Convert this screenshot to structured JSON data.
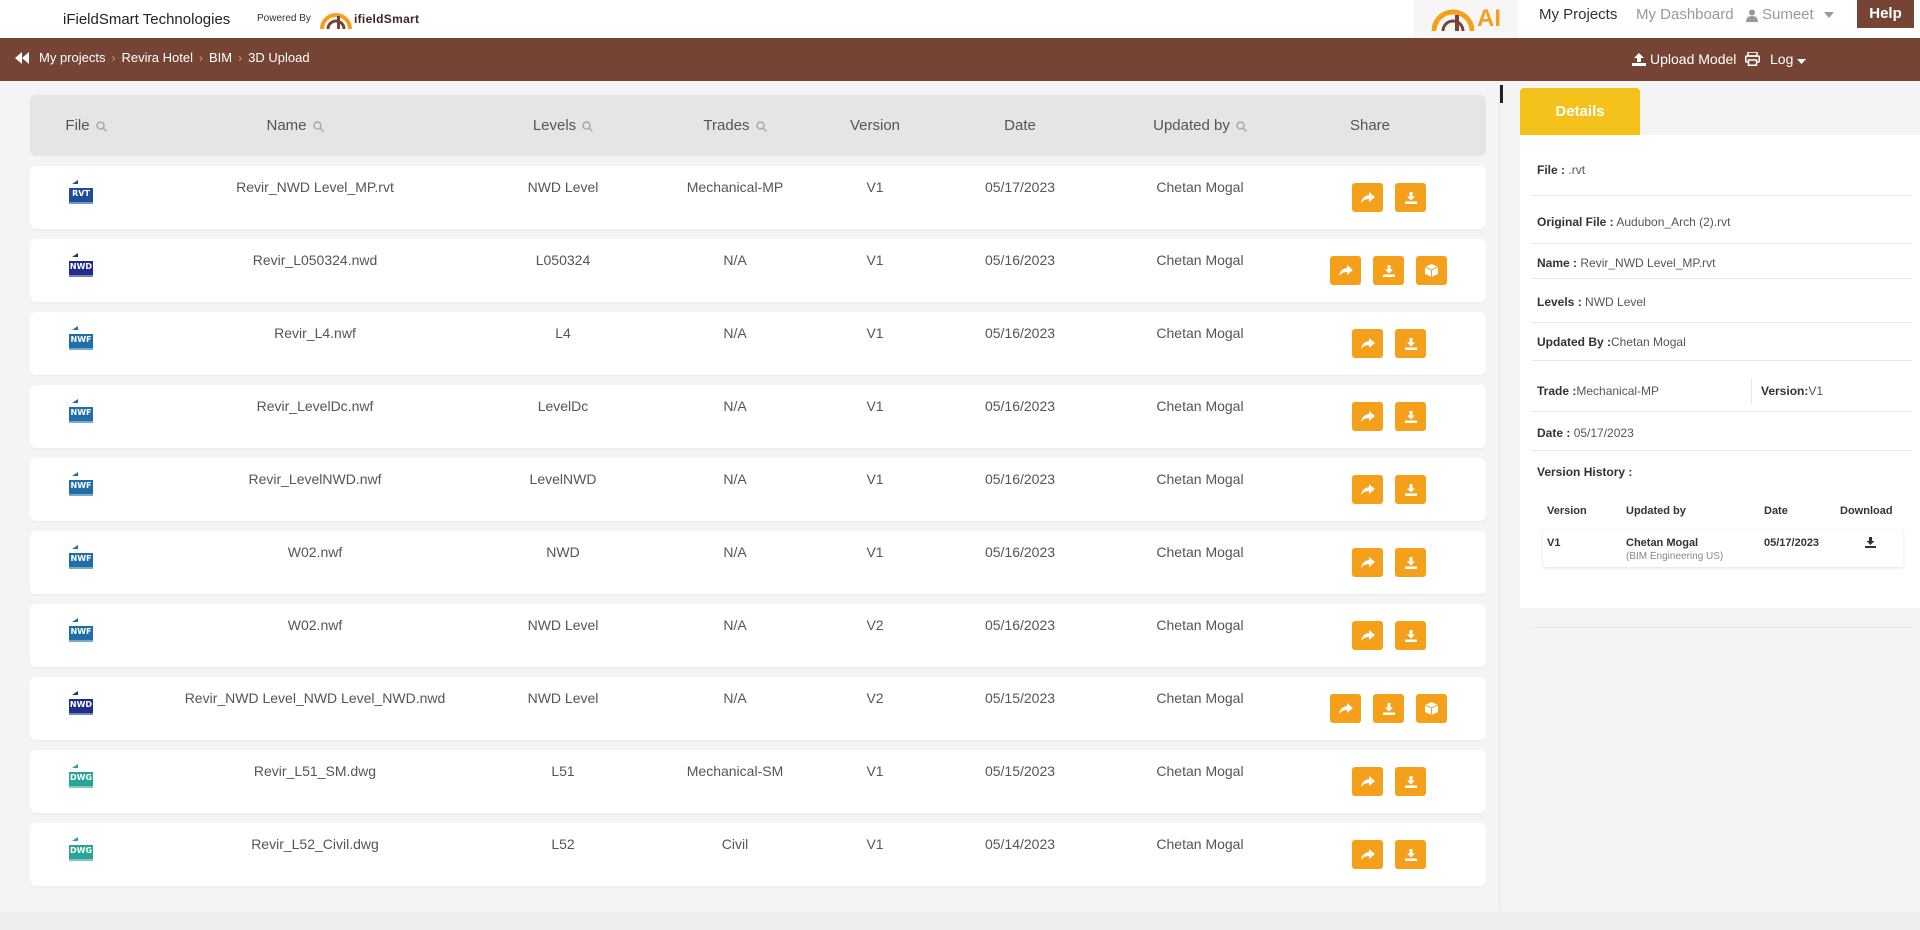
{
  "header": {
    "company": "iFieldSmart Technologies",
    "powered_by": "Powered By",
    "brand": "ifieldSmart",
    "ai_text": "AI",
    "nav": {
      "my_projects": "My Projects",
      "my_dashboard": "My Dashboard",
      "user": "Sumeet",
      "help": "Help"
    }
  },
  "navbar": {
    "breadcrumb": [
      "My projects",
      "Revira Hotel",
      "BIM",
      "3D Upload"
    ],
    "upload_model": "Upload Model",
    "log": "Log"
  },
  "table": {
    "columns": [
      "File",
      "Name",
      "Levels",
      "Trades",
      "Version",
      "Date",
      "Updated by",
      "Share"
    ],
    "rows": [
      {
        "type": "RVT",
        "name": "Revir_NWD Level_MP.rvt",
        "levels": "NWD Level",
        "trades": "Mechanical-MP",
        "version": "V1",
        "date": "05/17/2023",
        "updated_by": "Chetan Mogal",
        "viewer": false
      },
      {
        "type": "NWD",
        "name": "Revir_L050324.nwd",
        "levels": "L050324",
        "trades": "N/A",
        "version": "V1",
        "date": "05/16/2023",
        "updated_by": "Chetan Mogal",
        "viewer": true
      },
      {
        "type": "NWF",
        "name": "Revir_L4.nwf",
        "levels": "L4",
        "trades": "N/A",
        "version": "V1",
        "date": "05/16/2023",
        "updated_by": "Chetan Mogal",
        "viewer": false
      },
      {
        "type": "NWF",
        "name": "Revir_LevelDc.nwf",
        "levels": "LevelDc",
        "trades": "N/A",
        "version": "V1",
        "date": "05/16/2023",
        "updated_by": "Chetan Mogal",
        "viewer": false
      },
      {
        "type": "NWF",
        "name": "Revir_LevelNWD.nwf",
        "levels": "LevelNWD",
        "trades": "N/A",
        "version": "V1",
        "date": "05/16/2023",
        "updated_by": "Chetan Mogal",
        "viewer": false
      },
      {
        "type": "NWF",
        "name": "W02.nwf",
        "levels": "NWD",
        "trades": "N/A",
        "version": "V1",
        "date": "05/16/2023",
        "updated_by": "Chetan Mogal",
        "viewer": false
      },
      {
        "type": "NWF",
        "name": "W02.nwf",
        "levels": "NWD Level",
        "trades": "N/A",
        "version": "V2",
        "date": "05/16/2023",
        "updated_by": "Chetan Mogal",
        "viewer": false
      },
      {
        "type": "NWD",
        "name": "Revir_NWD Level_NWD Level_NWD.nwd",
        "levels": "NWD Level",
        "trades": "N/A",
        "version": "V2",
        "date": "05/15/2023",
        "updated_by": "Chetan Mogal",
        "viewer": true
      },
      {
        "type": "DWG",
        "name": "Revir_L51_SM.dwg",
        "levels": "L51",
        "trades": "Mechanical-SM",
        "version": "V1",
        "date": "05/15/2023",
        "updated_by": "Chetan Mogal",
        "viewer": false
      },
      {
        "type": "DWG",
        "name": "Revir_L52_Civil.dwg",
        "levels": "L52",
        "trades": "Civil",
        "version": "V1",
        "date": "05/14/2023",
        "updated_by": "Chetan Mogal",
        "viewer": false
      }
    ]
  },
  "details": {
    "tab": "Details",
    "file_label": "File :",
    "file_value": ".rvt",
    "original_label": "Original File :",
    "original_value": "Audubon_Arch (2).rvt",
    "name_label": "Name :",
    "name_value": "Revir_NWD Level_MP.rvt",
    "levels_label": "Levels :",
    "levels_value": "NWD Level",
    "updated_label": "Updated By :",
    "updated_value": "Chetan Mogal",
    "trade_label": "Trade :",
    "trade_value": "Mechanical-MP",
    "version_label": "Version:",
    "version_value": "V1",
    "date_label": "Date :",
    "date_value": "05/17/2023",
    "history_label": "Version History :",
    "history_columns": [
      "Version",
      "Updated by",
      "Date",
      "Download"
    ],
    "history_rows": [
      {
        "version": "V1",
        "updated_by": "Chetan Mogal",
        "company": "(BIM Engineering US)",
        "date": "05/17/2023"
      }
    ]
  },
  "colors": {
    "brand_brown": "#754434",
    "accent_orange": "#f4a01a",
    "details_yellow": "#f4c21a"
  }
}
